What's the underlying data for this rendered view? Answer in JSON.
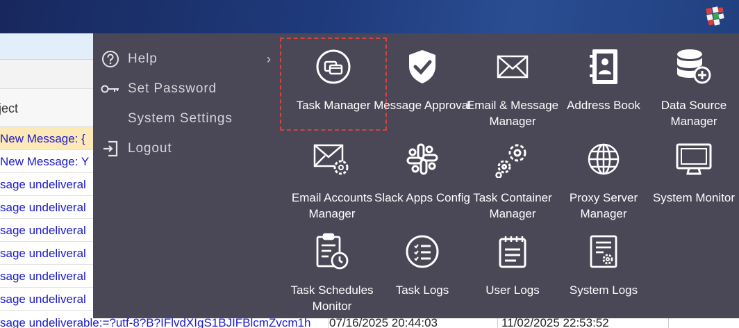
{
  "background": {
    "column_header": "ject",
    "rows": [
      {
        "subject": "New Message: {",
        "selected": true
      },
      {
        "subject": "New Message: Y",
        "selected": false
      },
      {
        "subject": "sage undeliveral",
        "selected": false
      },
      {
        "subject": "sage undeliveral",
        "selected": false
      },
      {
        "subject": "sage undeliveral",
        "selected": false
      },
      {
        "subject": "sage undeliveral",
        "selected": false
      },
      {
        "subject": "sage undeliveral",
        "selected": false
      },
      {
        "subject": "sage undeliveral",
        "selected": false
      }
    ],
    "last_row": {
      "subject": "sage undeliverable:=?utf-8?B?IFlvdXIgS1BJIFBlcmZvcm1h",
      "date1": "07/16/2025 20:44:03",
      "date2": "11/02/2025 22:53:52"
    }
  },
  "menu": {
    "left_items": [
      {
        "label": "Help",
        "icon": "help-icon",
        "has_submenu": true
      },
      {
        "label": "Set Password",
        "icon": "key-icon",
        "has_submenu": false
      },
      {
        "label": "System Settings",
        "icon": "",
        "has_submenu": false
      },
      {
        "label": "Logout",
        "icon": "logout-icon",
        "has_submenu": false
      }
    ],
    "chevron": "›",
    "tiles": [
      {
        "label": "Task Manager",
        "icon": "task-manager-icon",
        "focused": true
      },
      {
        "label": "Message Approval",
        "icon": "shield-check-icon"
      },
      {
        "label": "Email & Message Manager",
        "icon": "envelope-icon"
      },
      {
        "label": "Address Book",
        "icon": "address-book-icon"
      },
      {
        "label": "Data Source Manager",
        "icon": "database-add-icon"
      },
      {
        "label": "Email Accounts Manager",
        "icon": "email-gear-icon"
      },
      {
        "label": "Slack Apps Config",
        "icon": "slack-icon"
      },
      {
        "label": "Task Container Manager",
        "icon": "gears-icon"
      },
      {
        "label": "Proxy Server Manager",
        "icon": "globe-icon"
      },
      {
        "label": "System Monitor",
        "icon": "monitor-icon"
      },
      {
        "label": "Task Schedules Monitor",
        "icon": "clipboard-clock-icon"
      },
      {
        "label": "Task Logs",
        "icon": "list-icon"
      },
      {
        "label": "User Logs",
        "icon": "notepad-icon"
      },
      {
        "label": "System Logs",
        "icon": "document-gear-icon"
      }
    ]
  }
}
